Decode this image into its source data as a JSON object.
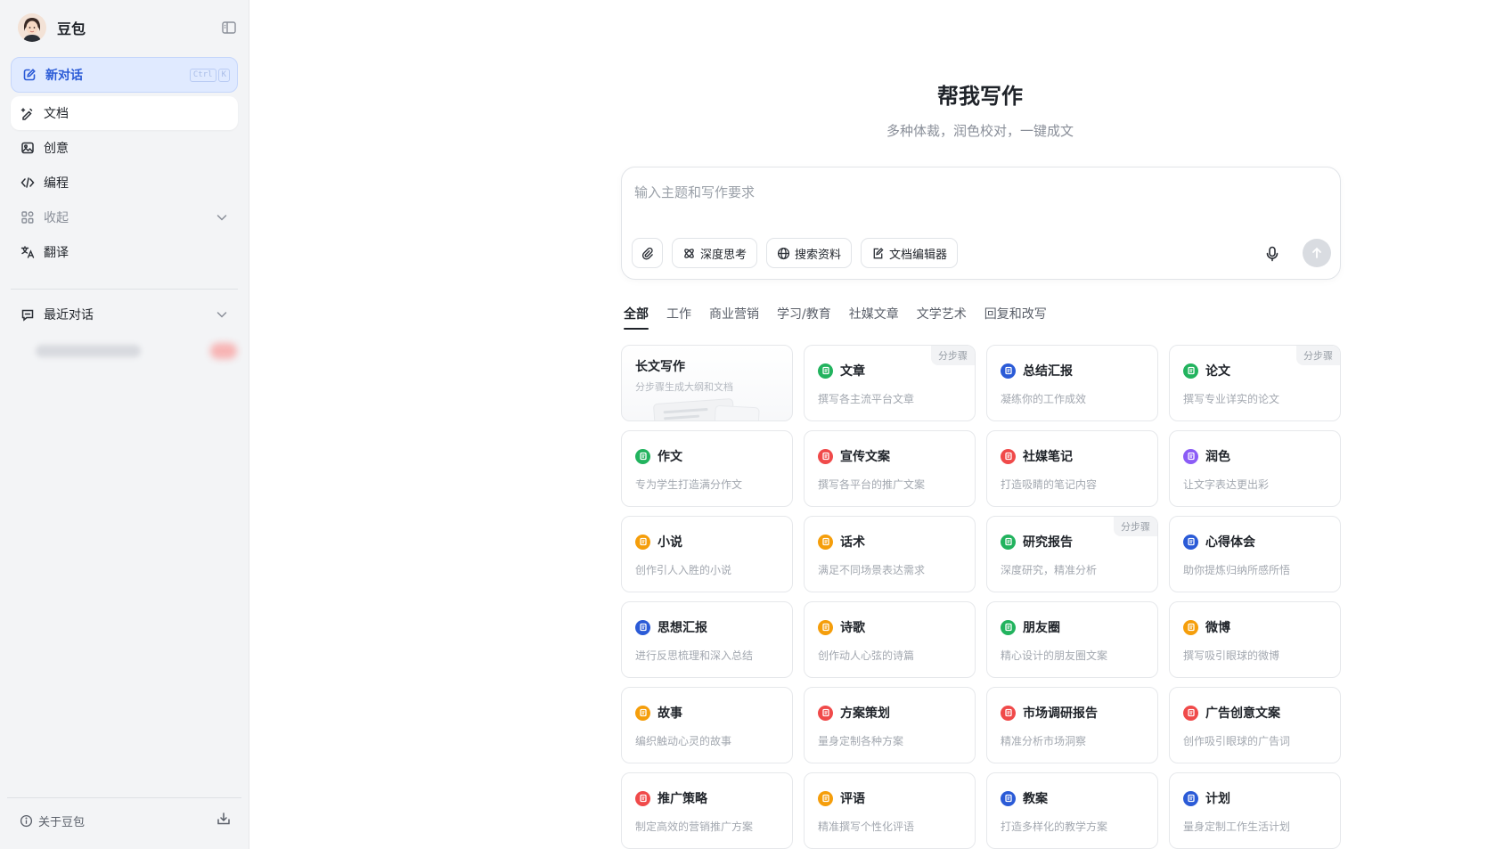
{
  "brand": {
    "name": "豆包"
  },
  "sidebar": {
    "new_chat": {
      "label": "新对话",
      "shortcut": [
        "Ctrl",
        "K"
      ]
    },
    "items": [
      {
        "label": "文档",
        "icon": "pen-sparkle-icon",
        "active": true
      },
      {
        "label": "创意",
        "icon": "image-icon"
      },
      {
        "label": "编程",
        "icon": "code-icon"
      },
      {
        "label": "收起",
        "icon": "grid-apps-icon",
        "muted": true
      },
      {
        "label": "翻译",
        "icon": "translate-icon"
      }
    ],
    "recent": {
      "label": "最近对话"
    },
    "about_label": "关于豆包"
  },
  "main": {
    "title": "帮我写作",
    "subtitle": "多种体裁，润色校对，一键成文",
    "composer": {
      "placeholder": "输入主题和写作要求",
      "tools": [
        "深度思考",
        "搜索资料",
        "文档编辑器"
      ]
    },
    "tabs": [
      "全部",
      "工作",
      "商业营销",
      "学习/教育",
      "社媒文章",
      "文学艺术",
      "回复和改写"
    ],
    "hero_card": {
      "title": "长文写作",
      "desc": "分步骤生成大纲和文档"
    },
    "cards": [
      {
        "title": "文章",
        "desc": "撰写各主流平台文章",
        "color": "#22b35e",
        "badge": "分步骤"
      },
      {
        "title": "总结汇报",
        "desc": "凝练你的工作成效",
        "color": "#2b5bd7"
      },
      {
        "title": "论文",
        "desc": "撰写专业详实的论文",
        "color": "#22b35e",
        "badge": "分步骤"
      },
      {
        "title": "作文",
        "desc": "专为学生打造满分作文",
        "color": "#22b35e"
      },
      {
        "title": "宣传文案",
        "desc": "撰写各平台的推广文案",
        "color": "#f04a4a"
      },
      {
        "title": "社媒笔记",
        "desc": "打造吸睛的笔记内容",
        "color": "#f04a4a"
      },
      {
        "title": "润色",
        "desc": "让文字表达更出彩",
        "color": "#8b5cf6"
      },
      {
        "title": "小说",
        "desc": "创作引人入胜的小说",
        "color": "#f59e0b"
      },
      {
        "title": "话术",
        "desc": "满足不同场景表达需求",
        "color": "#f59e0b"
      },
      {
        "title": "研究报告",
        "desc": "深度研究，精准分析",
        "color": "#22b35e",
        "badge": "分步骤"
      },
      {
        "title": "心得体会",
        "desc": "助你提炼归纳所感所悟",
        "color": "#2b5bd7"
      },
      {
        "title": "思想汇报",
        "desc": "进行反思梳理和深入总结",
        "color": "#2b5bd7"
      },
      {
        "title": "诗歌",
        "desc": "创作动人心弦的诗篇",
        "color": "#f59e0b"
      },
      {
        "title": "朋友圈",
        "desc": "精心设计的朋友圈文案",
        "color": "#22b35e"
      },
      {
        "title": "微博",
        "desc": "撰写吸引眼球的微博",
        "color": "#f59e0b"
      },
      {
        "title": "故事",
        "desc": "编织触动心灵的故事",
        "color": "#f59e0b"
      },
      {
        "title": "方案策划",
        "desc": "量身定制各种方案",
        "color": "#f04a4a"
      },
      {
        "title": "市场调研报告",
        "desc": "精准分析市场洞察",
        "color": "#f04a4a"
      },
      {
        "title": "广告创意文案",
        "desc": "创作吸引眼球的广告词",
        "color": "#f04a4a"
      },
      {
        "title": "推广策略",
        "desc": "制定高效的营销推广方案",
        "color": "#f04a4a"
      },
      {
        "title": "评语",
        "desc": "精准撰写个性化评语",
        "color": "#f59e0b"
      },
      {
        "title": "教案",
        "desc": "打造多样化的教学方案",
        "color": "#2b5bd7"
      },
      {
        "title": "计划",
        "desc": "量身定制工作生活计划",
        "color": "#2b5bd7"
      }
    ]
  }
}
